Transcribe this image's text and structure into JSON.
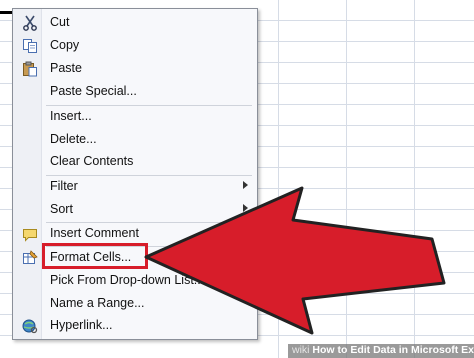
{
  "menu": {
    "items": [
      {
        "label": "Cut",
        "icon": "scissors-icon"
      },
      {
        "label": "Copy",
        "icon": "copy-icon"
      },
      {
        "label": "Paste",
        "icon": "clipboard-paste-icon"
      },
      {
        "label": "Paste Special..."
      },
      {
        "label": "Insert..."
      },
      {
        "label": "Delete..."
      },
      {
        "label": "Clear Contents"
      },
      {
        "label": "Filter",
        "submenu": true
      },
      {
        "label": "Sort",
        "submenu": true
      },
      {
        "label": "Insert Comment",
        "icon": "comment-icon"
      },
      {
        "label": "Format Cells...",
        "icon": "format-cells-icon",
        "highlighted": true
      },
      {
        "label": "Pick From Drop-down List..."
      },
      {
        "label": "Name a Range..."
      },
      {
        "label": "Hyperlink...",
        "icon": "hyperlink-globe-icon"
      }
    ]
  },
  "annotation": {
    "highlight_color": "#d71d2a",
    "arrow_color": "#d71d2a"
  },
  "watermark": {
    "site": "wiki",
    "text": "How to Edit Data in Microsoft Excel"
  }
}
